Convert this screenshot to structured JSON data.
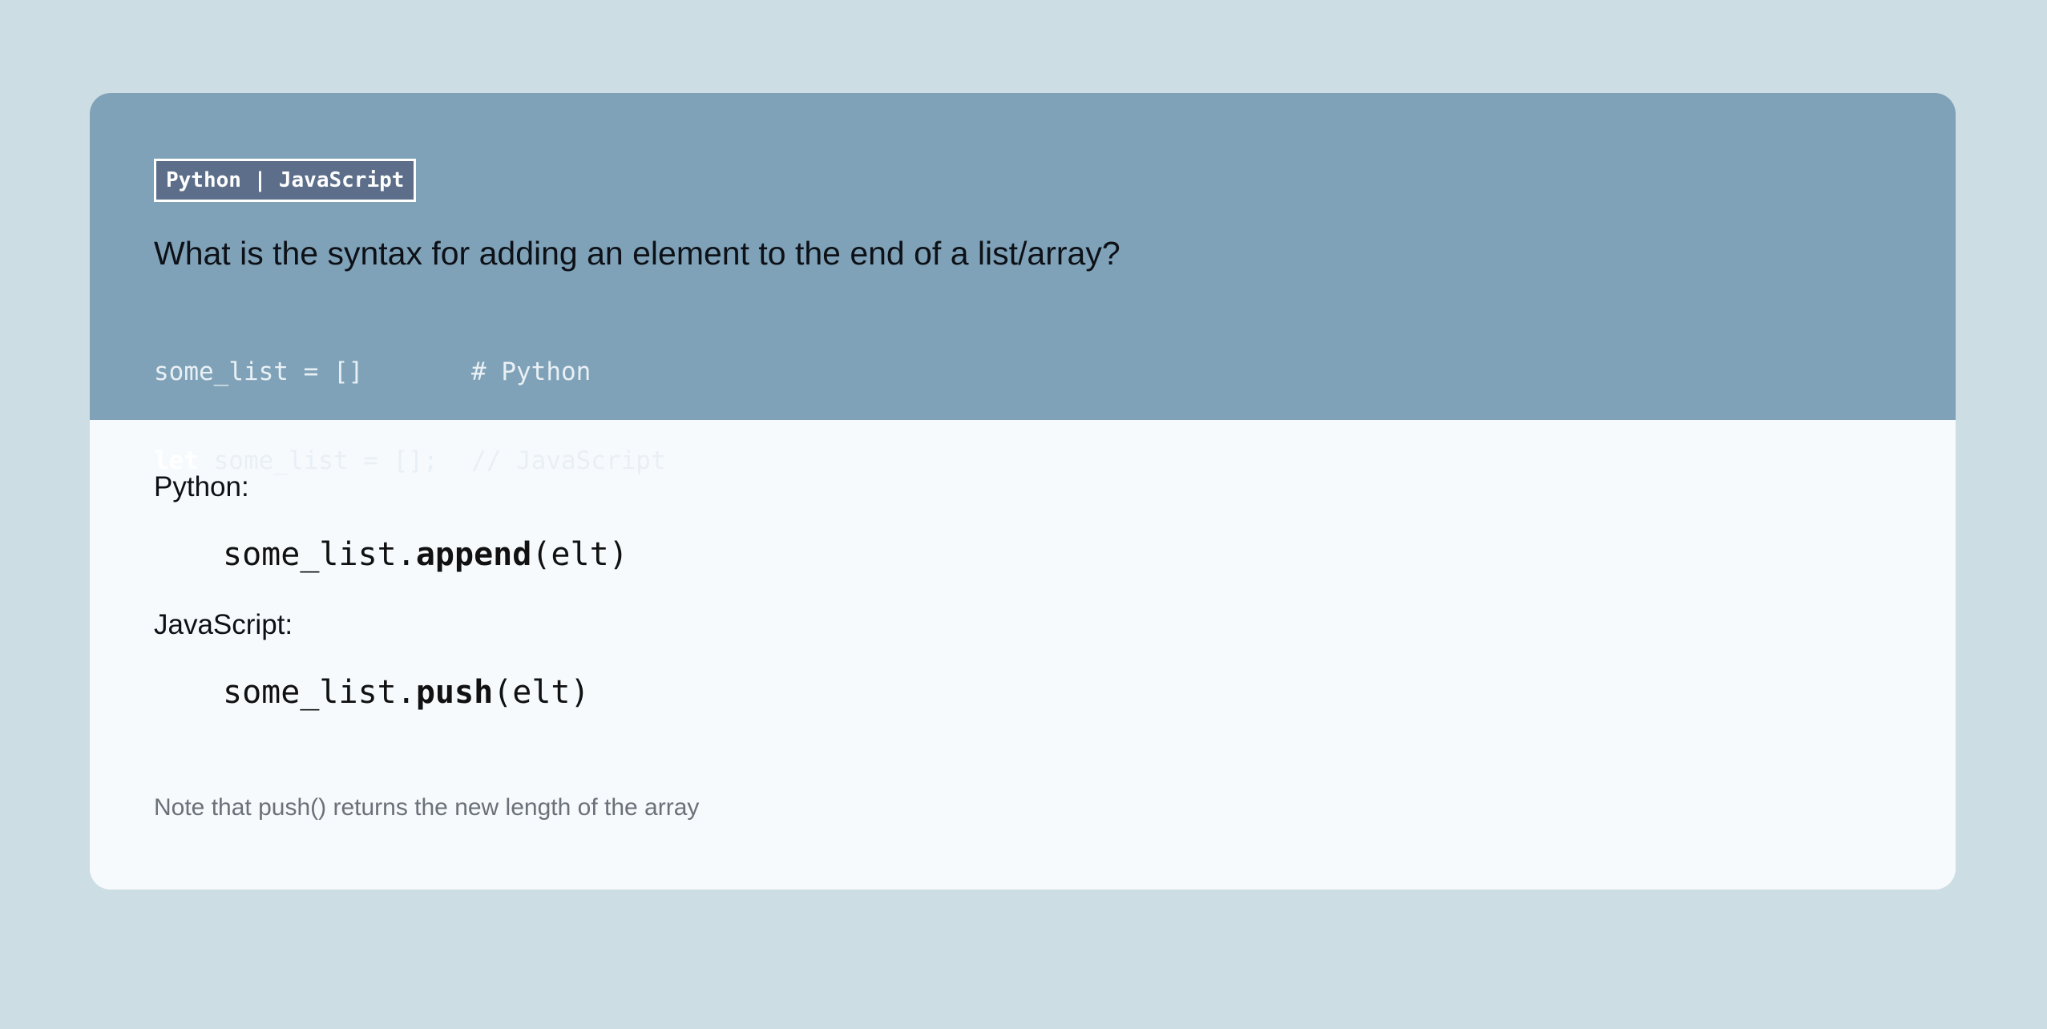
{
  "card": {
    "tag": "Python | JavaScript",
    "question": "What is the syntax for adding an element to the end of a list/array?",
    "front_code": [
      {
        "keyword": "",
        "code": "some_list = []",
        "comment": "# Python"
      },
      {
        "keyword": "let",
        "code": " some_list = [];",
        "comment": "// JavaScript"
      }
    ],
    "answer": {
      "python_label": "Python:",
      "python_code": {
        "prefix": "some_list.",
        "method": "append",
        "suffix": "(elt)"
      },
      "javascript_label": "JavaScript:",
      "javascript_code": {
        "prefix": "some_list.",
        "method": "push",
        "suffix": "(elt)"
      },
      "note": "Note that push() returns the new length of the array"
    }
  },
  "colors": {
    "page_background": "#cddde4",
    "card_front": "#7fa2b8",
    "card_back": "#f6fafd",
    "tag_background": "#5c6e8a"
  }
}
